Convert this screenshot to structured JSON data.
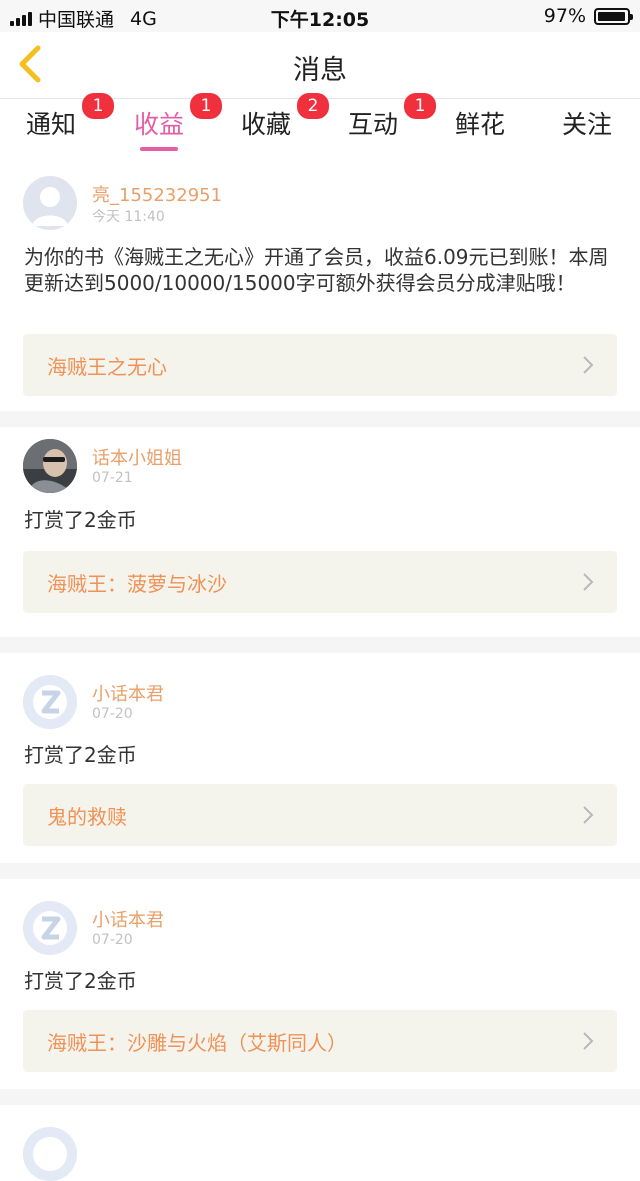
{
  "status_bar": {
    "carrier": "中国联通",
    "network": "4G",
    "time": "下午12:05",
    "battery": "97%",
    "battery_level": 0.97
  },
  "nav": {
    "title": "消息",
    "back_icon": "chevron-left-icon",
    "accent_color": "#f4c01d"
  },
  "tabs": [
    {
      "label": "通知",
      "badge": "1"
    },
    {
      "label": "收益",
      "badge": "1",
      "active": true
    },
    {
      "label": "收藏",
      "badge": "2"
    },
    {
      "label": "互动",
      "badge": "1"
    },
    {
      "label": "鲜花",
      "badge": ""
    },
    {
      "label": "关注",
      "badge": ""
    }
  ],
  "colors": {
    "active_tab": "#e35ea6",
    "badge": "#f1303e",
    "username": "#e8a06a",
    "book_link": "#ef9257"
  },
  "messages": [
    {
      "username": "亮_155232951",
      "time": "今天 11:40",
      "avatar": "default-avatar-icon",
      "text": "为你的书《海贼王之无心》开通了会员，收益6.09元已到账！本周更新达到5000/10000/15000字可额外获得会员分成津贴哦！",
      "book": "海贼王之无心"
    },
    {
      "username": "话本小姐姐",
      "time": "07-21",
      "avatar": "user-photo-avatar",
      "text": "打赏了2金币",
      "book": "海贼王：菠萝与冰沙"
    },
    {
      "username": "小话本君",
      "time": "07-20",
      "avatar": "app-logo-avatar",
      "text": "打赏了2金币",
      "book": "鬼的救赎"
    },
    {
      "username": "小话本君",
      "time": "07-20",
      "avatar": "app-logo-avatar",
      "text": "打赏了2金币",
      "book": "海贼王：沙雕与火焰（艾斯同人）"
    }
  ]
}
